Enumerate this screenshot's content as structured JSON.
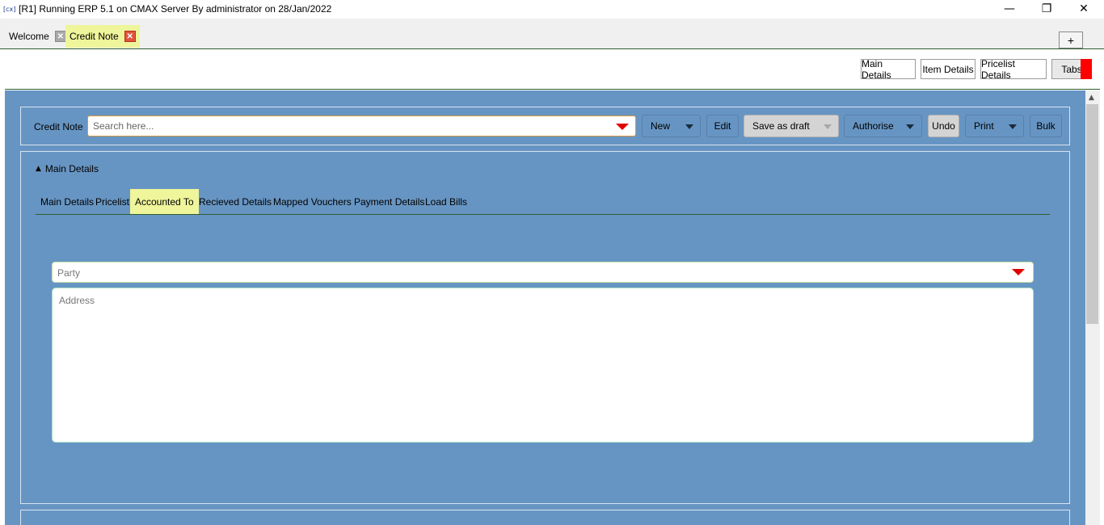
{
  "window": {
    "icon_text": "[cx]",
    "title": "[R1] Running ERP 5.1 on CMAX Server By administrator on 28/Jan/2022",
    "minimize_glyph": "—",
    "maximize_glyph": "❐",
    "close_glyph": "✕"
  },
  "tabs": [
    {
      "label": "Welcome",
      "close_glyph": "✕"
    },
    {
      "label": "Credit Note",
      "close_glyph": "✕"
    }
  ],
  "add_tab_label": "+",
  "upper_toolbar": {
    "main_details": "Main Details",
    "item_details": "Item Details",
    "pricelist_details": "Pricelist Details",
    "tabs": "Tabs"
  },
  "toolbar": {
    "label": "Credit Note",
    "search_placeholder": "Search here...",
    "new": "New",
    "edit": "Edit",
    "save_as_draft": "Save as draft",
    "authorise": "Authorise",
    "undo": "Undo",
    "print": "Print",
    "bulk": "Bulk"
  },
  "section": {
    "caret": "▲",
    "title": "Main Details"
  },
  "subtabs": [
    {
      "label": "Main Details"
    },
    {
      "label": "Pricelist"
    },
    {
      "label": "Accounted To"
    },
    {
      "label": "Recieved Details"
    },
    {
      "label": "Mapped Vouchers"
    },
    {
      "label": "Payment Details"
    },
    {
      "label": "Load Bills"
    }
  ],
  "active_subtab": "Accounted To",
  "form": {
    "party_placeholder": "Party",
    "address_placeholder": "Address"
  },
  "scrollbar": {
    "up_glyph": "▲"
  },
  "colors": {
    "workspace": "#6795c3",
    "active_tab": "#eef59a",
    "dropdown_arrow": "#e00000",
    "marker": "#ff0000"
  }
}
